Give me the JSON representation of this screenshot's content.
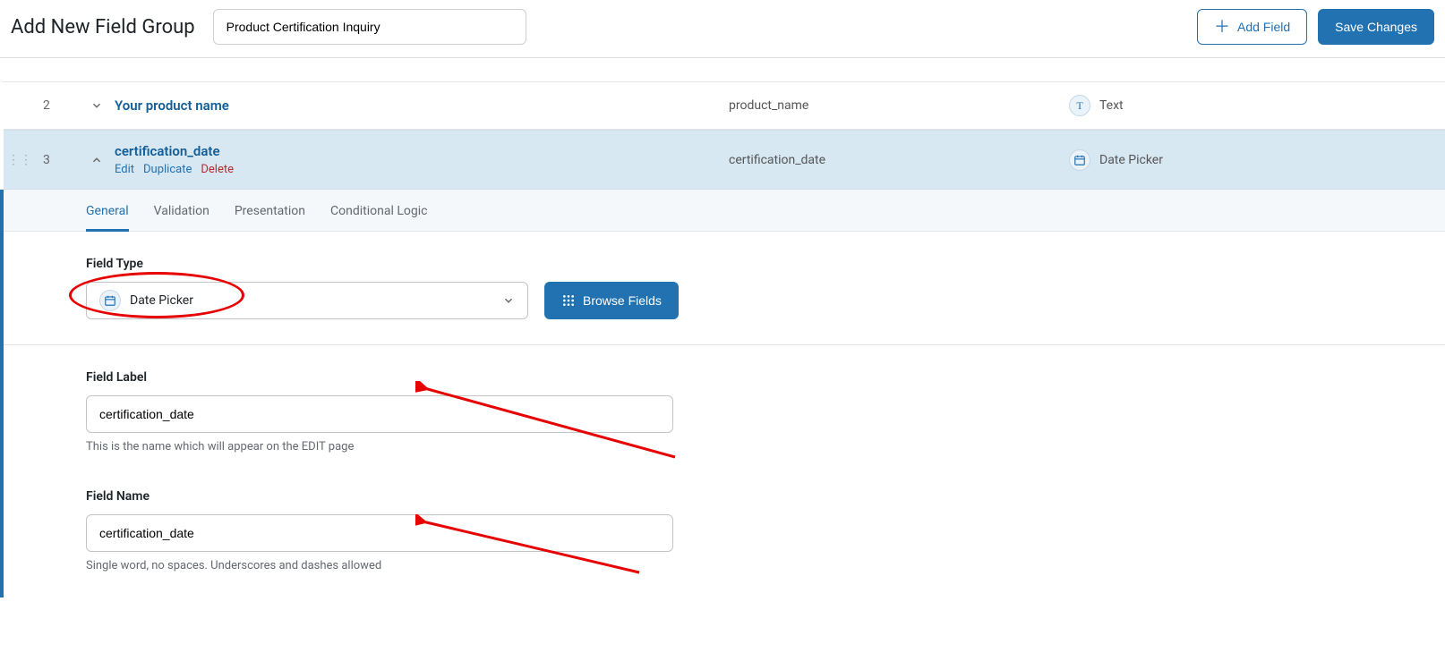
{
  "header": {
    "page_title": "Add New Field Group",
    "group_title": "Product Certification Inquiry",
    "add_field_label": "Add Field",
    "save_label": "Save Changes"
  },
  "fields": [
    {
      "index": "2",
      "label": "Your product name",
      "name": "product_name",
      "type_label": "Text",
      "expanded": false
    },
    {
      "index": "3",
      "label": "certification_date",
      "name": "certification_date",
      "type_label": "Date Picker",
      "expanded": true,
      "actions": {
        "edit": "Edit",
        "duplicate": "Duplicate",
        "delete": "Delete"
      }
    }
  ],
  "tabs": {
    "general": "General",
    "validation": "Validation",
    "presentation": "Presentation",
    "conditional": "Conditional Logic",
    "active": "general"
  },
  "settings": {
    "field_type_label": "Field Type",
    "field_type_value": "Date Picker",
    "browse_fields_label": "Browse Fields",
    "field_label_label": "Field Label",
    "field_label_value": "certification_date",
    "field_label_hint": "This is the name which will appear on the EDIT page",
    "field_name_label": "Field Name",
    "field_name_value": "certification_date",
    "field_name_hint": "Single word, no spaces. Underscores and dashes allowed"
  }
}
